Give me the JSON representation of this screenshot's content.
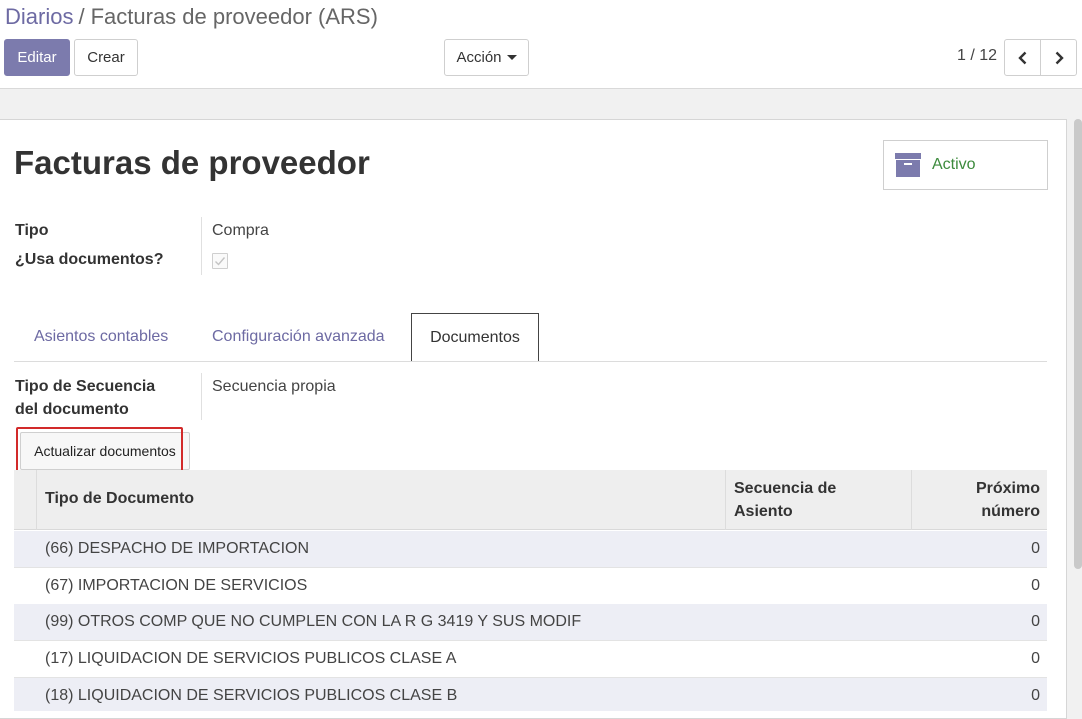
{
  "breadcrumb": {
    "parent": "Diarios",
    "separator": "/",
    "current": "Facturas de proveedor (ARS)"
  },
  "toolbar": {
    "edit_label": "Editar",
    "create_label": "Crear",
    "action_label": "Acción"
  },
  "pager": {
    "value": "1 / 12"
  },
  "record": {
    "title": "Facturas de proveedor",
    "active_button": "Activo",
    "fields": {
      "tipo_label": "Tipo",
      "tipo_value": "Compra",
      "usa_documentos_label": "¿Usa documentos?",
      "usa_documentos_checked": true
    }
  },
  "tabs": [
    {
      "label": "Asientos contables",
      "active": false
    },
    {
      "label": "Configuración avanzada",
      "active": false
    },
    {
      "label": "Documentos",
      "active": true
    }
  ],
  "documents_tab": {
    "sequence_type_label_line1": "Tipo de Secuencia",
    "sequence_type_label_line2": "del documento",
    "sequence_type_value": "Secuencia propia",
    "update_button": "Actualizar documentos",
    "table": {
      "columns": {
        "document_type": "Tipo de Documento",
        "entry_sequence_line1": "Secuencia de",
        "entry_sequence_line2": "Asiento",
        "next_number_line1": "Próximo",
        "next_number_line2": "número"
      },
      "rows": [
        {
          "document": "(66) DESPACHO DE IMPORTACION",
          "sequence": "",
          "next_number": "0"
        },
        {
          "document": "(67) IMPORTACION DE SERVICIOS",
          "sequence": "",
          "next_number": "0"
        },
        {
          "document": "(99) OTROS COMP QUE NO CUMPLEN CON LA R G 3419 Y SUS MODIF",
          "sequence": "",
          "next_number": "0"
        },
        {
          "document": "(17) LIQUIDACION DE SERVICIOS PUBLICOS CLASE A",
          "sequence": "",
          "next_number": "0"
        },
        {
          "document": "(18) LIQUIDACION DE SERVICIOS PUBLICOS CLASE B",
          "sequence": "",
          "next_number": "0"
        }
      ]
    }
  },
  "colors": {
    "primary": "#7c7bad",
    "link": "#6d6aa3",
    "active_green": "#3c8a3c",
    "highlight_red": "#d22a2a"
  },
  "icons": {
    "archive": "archive-icon",
    "prev": "chevron-left-icon",
    "next": "chevron-right-icon",
    "check": "check-icon"
  }
}
